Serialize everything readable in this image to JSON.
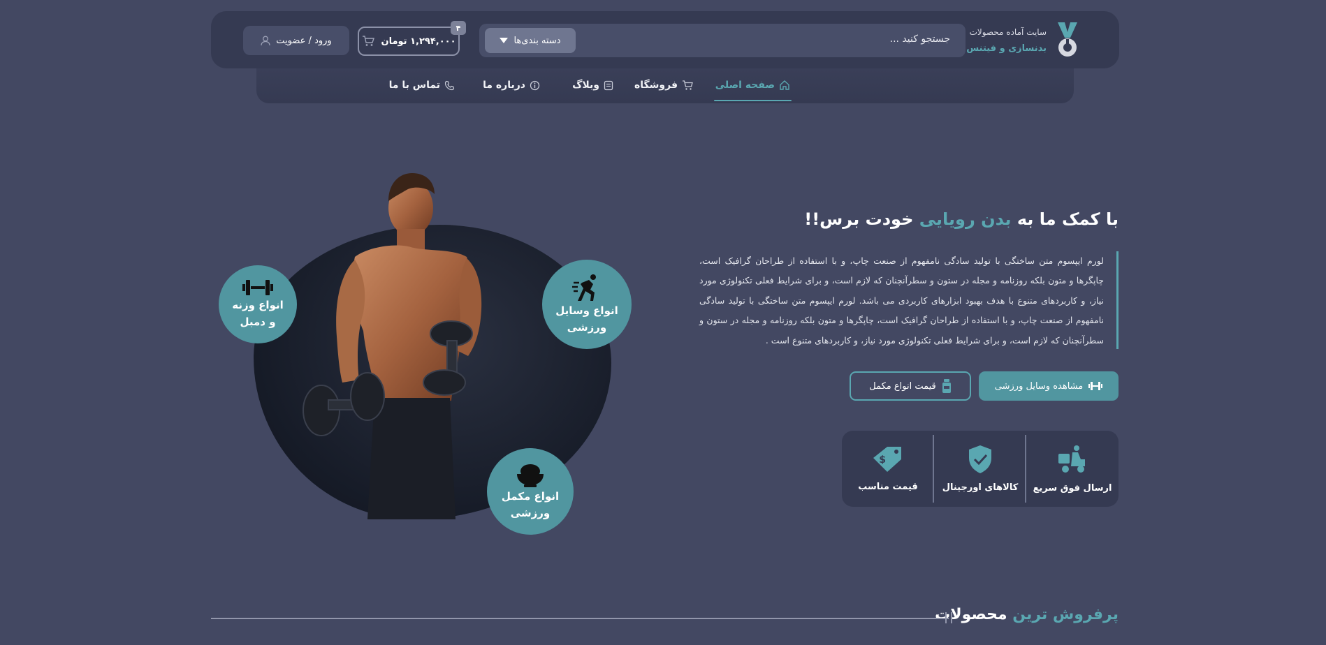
{
  "header": {
    "brand_line1": "سایت آماده محصولات",
    "brand_line2": "بدنسازی و فیتنس",
    "search_placeholder": "جستجو کنید ...",
    "categories_label": "دسته بندی‌ها",
    "cart_total": "۱,۲۹۴,۰۰۰ تومان",
    "cart_count": "۴",
    "login_label": "ورود / عضویت"
  },
  "nav": {
    "items": [
      {
        "label": "صفحه اصلی",
        "icon": "home-icon",
        "active": true
      },
      {
        "label": "فروشگاه",
        "icon": "cart-icon"
      },
      {
        "label": "وبلاگ",
        "icon": "blog-icon"
      },
      {
        "label": "درباره ما",
        "icon": "info-icon"
      },
      {
        "label": "تماس با ما",
        "icon": "phone-icon"
      }
    ]
  },
  "hero": {
    "title_part1": "با کمک ما به ",
    "title_highlight": "بدن رویایی",
    "title_part2": " خودت برس!!",
    "paragraph": "لورم ایپسوم متن ساختگی با تولید سادگی نامفهوم از صنعت چاپ، و با استفاده از طراحان گرافیک است، چاپگرها و متون بلکه روزنامه و مجله در ستون و سطرآنچنان که لازم است، و برای شرایط فعلی تکنولوژی مورد نیاز، و کاربردهای متنوع با هدف بهبود ابزارهای کاربردی می باشد. لورم ایپسوم متن ساختگی با تولید سادگی نامفهوم از صنعت چاپ، و با استفاده از طراحان گرافیک است، چاپگرها و متون بلکه روزنامه و مجله در ستون و سطرآنچنان که لازم است، و برای شرایط فعلی تکنولوژی مورد نیاز، و کاربردهای متنوع است .",
    "primary_button": "مشاهده وسایل ورزشی",
    "secondary_button": "قیمت انواع مکمل",
    "circles": {
      "equipment": "انواع وسایل\nورزشی",
      "weights": "انواع وزنه\nو دمبل",
      "supplements": "انواع مکمل\nورزشی"
    }
  },
  "features": [
    {
      "label": "ارسال فوق سریع",
      "icon": "fast-delivery-icon"
    },
    {
      "label": "کالاهای اورجینال",
      "icon": "shield-check-icon"
    },
    {
      "label": "قیمت مناسب",
      "icon": "price-tag-icon"
    }
  ],
  "section": {
    "title_highlight": "پرفروش ترین",
    "title_rest": " محصولات"
  },
  "colors": {
    "background": "#434862",
    "panel": "#353a52",
    "accent": "#5aa7b1"
  }
}
